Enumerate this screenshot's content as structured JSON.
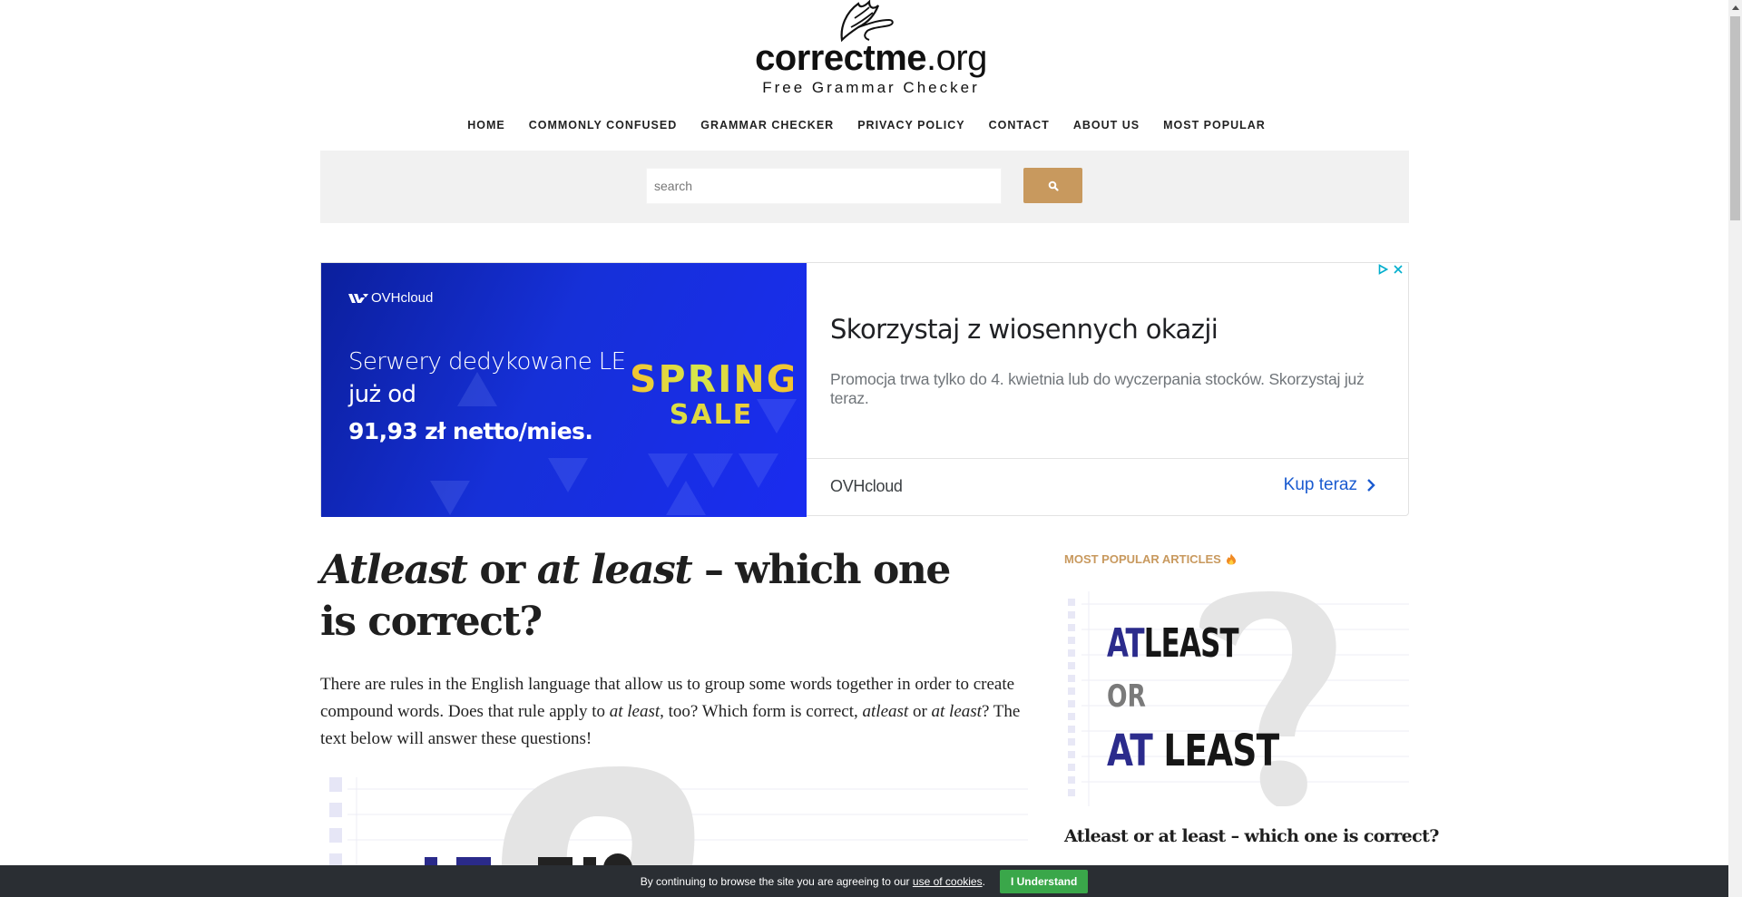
{
  "site": {
    "name_bold": "correctme",
    "name_tld": ".org",
    "tagline": "Free Grammar Checker"
  },
  "nav": {
    "items": [
      {
        "label": "HOME"
      },
      {
        "label": "COMMONLY CONFUSED"
      },
      {
        "label": "GRAMMAR CHECKER"
      },
      {
        "label": "PRIVACY POLICY"
      },
      {
        "label": "CONTACT"
      },
      {
        "label": "ABOUT US"
      },
      {
        "label": "MOST POPULAR"
      }
    ]
  },
  "search": {
    "placeholder": "search",
    "value": "",
    "button_icon": "search-icon"
  },
  "ad": {
    "brand": "OVHcloud",
    "image_line1": "Serwery dedykowane LE",
    "image_line2": "już od",
    "image_line3": "91,93 zł netto/mies.",
    "badge_line1": "SPRING",
    "badge_line2": "SALE",
    "headline": "Skorzystaj z wiosennych okazji",
    "description": "Promocja trwa tylko do 4. kwietnia lub do wyczerpania stocków. Skorzystaj już teraz.",
    "advertiser": "OVHcloud",
    "cta": "Kup teraz",
    "colors": {
      "image_bg": "#1630d8",
      "cta": "#1a5bd0",
      "choices": "#00aecd"
    }
  },
  "article": {
    "title_parts": [
      "Atleast",
      " or ",
      "at least",
      " – which one is correct?"
    ],
    "intro_parts": [
      "There are rules in the English language that allow us to group some words together in order to create compound words. Does that rule apply to ",
      "at least",
      ", too? Which form is correct, ",
      "atleast",
      " or ",
      "at least",
      "? The text below will answer these questions!"
    ]
  },
  "sidebar": {
    "heading": "MOST POPULAR ARTICLES",
    "heading_icon": "fire-icon",
    "heading_color": "#c8995e",
    "articles": [
      {
        "image_words": {
          "line1_accent": "AT",
          "line1_rest": "LEAST",
          "line2": "OR",
          "line3_accent": "AT",
          "line3_rest": "LEAST"
        },
        "title": "Atleast or at least – which one is correct?"
      }
    ]
  },
  "cookie": {
    "text": "By continuing to browse the site you are agreeing to our ",
    "link": "use of cookies",
    "suffix": ".",
    "button": "I Understand",
    "button_color": "#3aa74a"
  }
}
